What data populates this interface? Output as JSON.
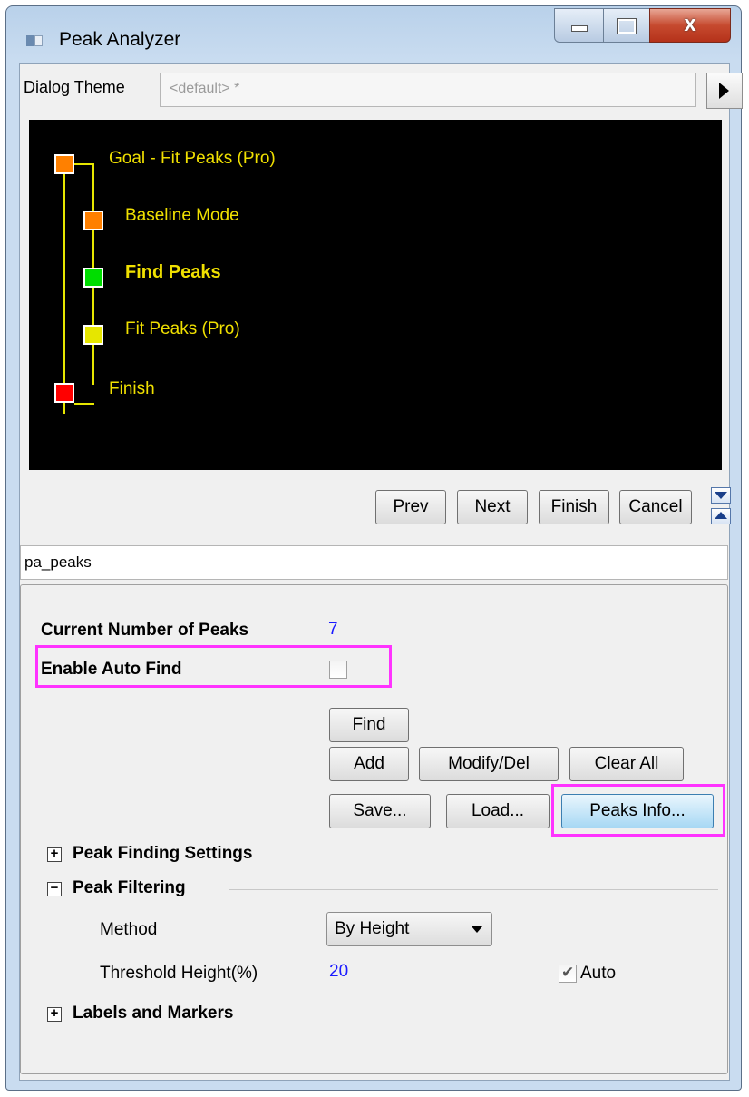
{
  "window": {
    "title": "Peak Analyzer",
    "close_glyph": "x"
  },
  "theme": {
    "label": "Dialog Theme",
    "value": "<default> *"
  },
  "flow": {
    "nodes": [
      {
        "label": "Goal - Fit Peaks (Pro)",
        "color": "#ff8000"
      },
      {
        "label": "Baseline Mode",
        "color": "#ff8000"
      },
      {
        "label": "Find Peaks",
        "color": "#00dd00"
      },
      {
        "label": "Fit Peaks (Pro)",
        "color": "#e6e600"
      },
      {
        "label": "Finish",
        "color": "#ff0000"
      }
    ]
  },
  "nav": {
    "prev": "Prev",
    "next": "Next",
    "finish": "Finish",
    "cancel": "Cancel"
  },
  "panel": {
    "title": "pa_peaks",
    "current_peaks_label": "Current Number of Peaks",
    "current_peaks_value": "7",
    "auto_find_label": "Enable Auto Find",
    "buttons": {
      "find": "Find",
      "add": "Add",
      "modify": "Modify/Del",
      "clear": "Clear All",
      "save": "Save...",
      "load": "Load...",
      "peaks_info": "Peaks Info..."
    },
    "sections": {
      "finding": "Peak Finding Settings",
      "filtering": "Peak Filtering",
      "labels": "Labels and Markers"
    },
    "filtering": {
      "method_label": "Method",
      "method_value": "By Height",
      "threshold_label": "Threshold Height(%)",
      "threshold_value": "20",
      "auto_label": "Auto"
    },
    "tree_expand": "+",
    "tree_collapse": "−"
  }
}
